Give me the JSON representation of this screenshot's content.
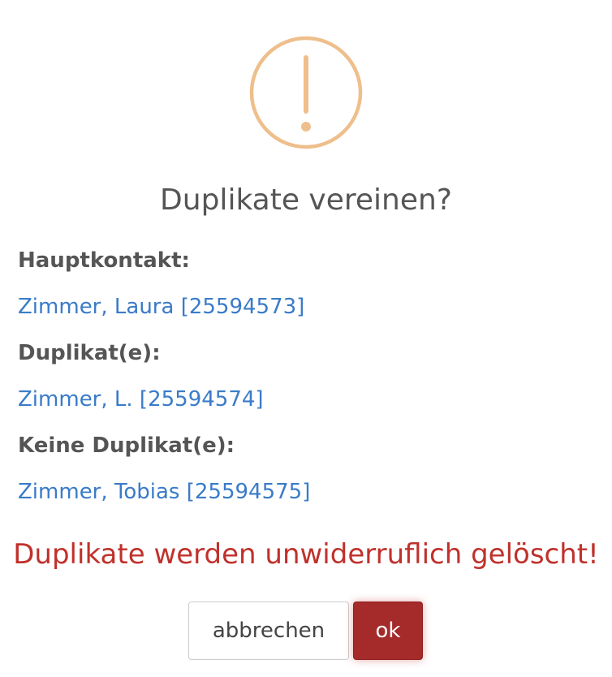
{
  "dialog": {
    "icon": "exclamation-circle-icon",
    "icon_color": "#eebf8c",
    "title": "Duplikate vereinen?",
    "main_contact_label": "Hauptkontakt:",
    "main_contact": "Zimmer, Laura [25594573]",
    "duplicates_label": "Duplikat(e):",
    "duplicates": [
      "Zimmer, L. [25594574]"
    ],
    "non_duplicates_label": "Keine Duplikat(e):",
    "non_duplicates": [
      "Zimmer, Tobias [25594575]"
    ],
    "warning": "Duplikate werden unwiderruflich gelöscht!",
    "warning_color": "#c0312b",
    "link_color": "#3a7bc8",
    "cancel_label": "abbrechen",
    "ok_label": "ok",
    "ok_color": "#a52a2a"
  }
}
